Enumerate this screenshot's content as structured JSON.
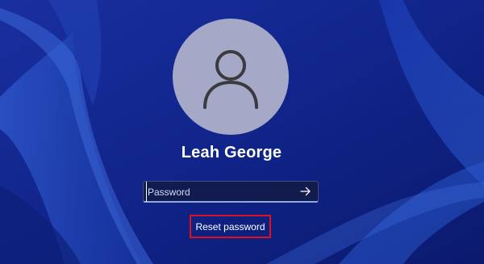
{
  "user": {
    "display_name": "Leah George",
    "avatar_icon": "person-icon"
  },
  "password_field": {
    "placeholder": "Password",
    "value": "",
    "submit_icon": "arrow-right-icon"
  },
  "reset_password": {
    "label": "Reset password",
    "highlight_color": "#e0101e"
  },
  "colors": {
    "background": "#12288f",
    "avatar_fill": "#a6a8c8",
    "text": "#ffffff"
  }
}
